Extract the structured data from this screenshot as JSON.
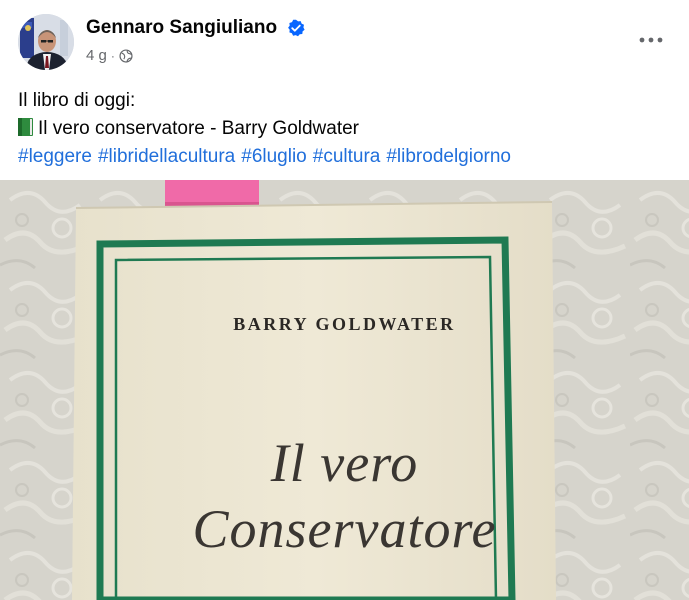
{
  "post": {
    "author": "Gennaro Sangiuliano",
    "verified": true,
    "time": "4 g",
    "privacy_icon": "globe-icon",
    "more_icon": "more-options-icon",
    "text_line1": "Il libro di oggi:",
    "book_emoji": "green-book-icon",
    "text_line2": "Il vero conservatore - Barry Goldwater",
    "hashtags": [
      "#leggere",
      "#libridellacultura",
      "#6luglio",
      "#cultura",
      "#librodelgiorno"
    ]
  },
  "photo": {
    "book_author": "BARRY GOLDWATER",
    "book_title_line1": "Il vero",
    "book_title_line2": "Conservatore"
  },
  "colors": {
    "link": "#216fdb",
    "verified_badge": "#0866ff",
    "secondary_text": "#65676b",
    "book_border": "#1f7a52",
    "book_cover": "#ece6d2",
    "bookmark": "#f06aa8"
  }
}
